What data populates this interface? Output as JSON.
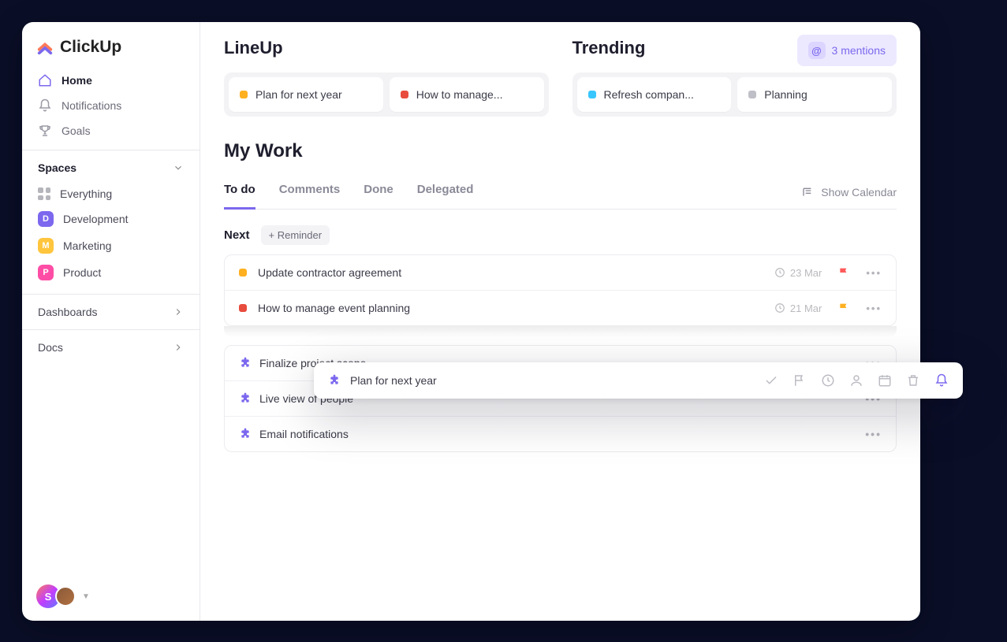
{
  "brand": {
    "name": "ClickUp"
  },
  "nav": {
    "home": "Home",
    "notifications": "Notifications",
    "goals": "Goals"
  },
  "spaces": {
    "header": "Spaces",
    "everything": "Everything",
    "items": [
      {
        "letter": "D",
        "label": "Development",
        "color": "#7b68ee"
      },
      {
        "letter": "M",
        "label": "Marketing",
        "color": "#ffc53d"
      },
      {
        "letter": "P",
        "label": "Product",
        "color": "#ff4da6"
      }
    ]
  },
  "sections": {
    "dashboards": "Dashboards",
    "docs": "Docs"
  },
  "mentions": {
    "label": "3 mentions"
  },
  "lineup": {
    "title": "LineUp",
    "items": [
      {
        "label": "Plan for next year",
        "color": "#ffb020"
      },
      {
        "label": "How to manage...",
        "color": "#e84c3d"
      }
    ]
  },
  "trending": {
    "title": "Trending",
    "items": [
      {
        "label": "Refresh compan...",
        "color": "#38c6ff"
      },
      {
        "label": "Planning",
        "color": "#bfbfc7"
      }
    ]
  },
  "mywork": {
    "title": "My Work",
    "tabs": [
      "To do",
      "Comments",
      "Done",
      "Delegated"
    ],
    "active_tab": 0,
    "show_calendar": "Show Calendar",
    "next_label": "Next",
    "reminder_btn": "+ Reminder",
    "group1": [
      {
        "label": "Update contractor agreement",
        "color": "#ffb020",
        "date": "23 Mar",
        "flag": "#ff5a5a"
      },
      {
        "label": "How to manage event planning",
        "color": "#e84c3d",
        "date": "21 Mar",
        "flag": "#ffb020"
      }
    ],
    "group2": [
      {
        "label": "Finalize project scope"
      },
      {
        "label": "Live view of people"
      },
      {
        "label": "Email notifications"
      }
    ]
  },
  "popover": {
    "title": "Plan for next year"
  },
  "avatar": {
    "letter": "S"
  }
}
